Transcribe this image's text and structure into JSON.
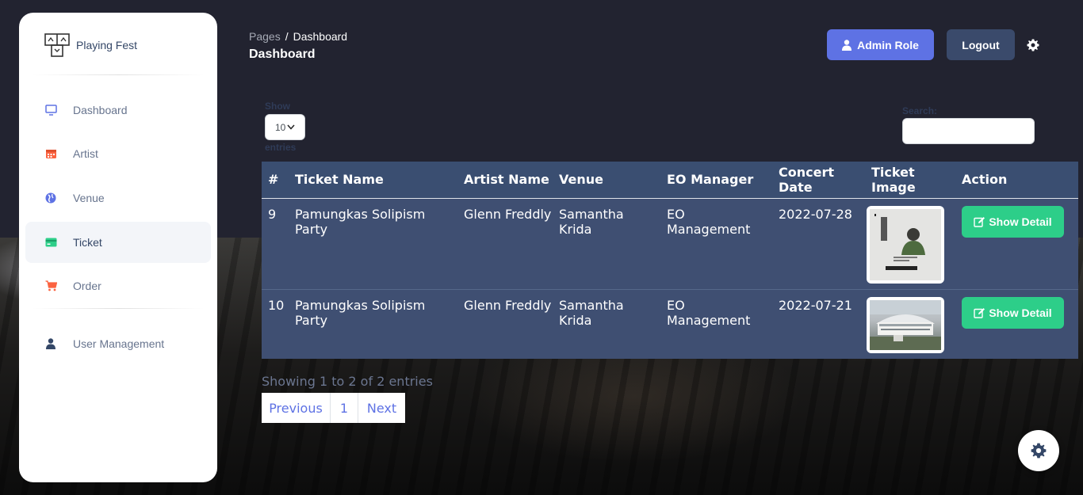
{
  "brand": {
    "name": "Playing Fest"
  },
  "sidebar": {
    "items": [
      {
        "label": "Dashboard",
        "icon": "monitor-icon"
      },
      {
        "label": "Artist",
        "icon": "calendar-icon"
      },
      {
        "label": "Venue",
        "icon": "globe-icon"
      },
      {
        "label": "Ticket",
        "icon": "credit-card-icon",
        "active": true
      },
      {
        "label": "Order",
        "icon": "cart-icon"
      },
      {
        "label": "User Management",
        "icon": "user-icon"
      }
    ]
  },
  "header": {
    "breadcrumb_parent": "Pages",
    "breadcrumb_separator": "/",
    "breadcrumb_current": "Dashboard",
    "title": "Dashboard",
    "admin_button": "Admin Role",
    "logout_button": "Logout"
  },
  "table_controls": {
    "length_show": "Show",
    "length_value": "10",
    "length_entries": "entries",
    "search_label": "Search:",
    "search_value": ""
  },
  "table": {
    "headers": [
      "#",
      "Ticket Name",
      "Artist Name",
      "Venue",
      "EO Manager",
      "Concert Date",
      "Ticket Image",
      "Action"
    ],
    "rows": [
      {
        "id": "9",
        "ticket_name": "Pamungkas Solipism Party",
        "artist": "Glenn Freddly",
        "venue": "Samantha Krida",
        "eo": "EO Management",
        "date": "2022-07-28",
        "action": "Show Detail"
      },
      {
        "id": "10",
        "ticket_name": "Pamungkas Solipism Party",
        "artist": "Glenn Freddly",
        "venue": "Samantha Krida",
        "eo": "EO Management",
        "date": "2022-07-21",
        "action": "Show Detail"
      }
    ]
  },
  "footer": {
    "info": "Showing 1 to 2 of 2 entries",
    "pagination": {
      "previous": "Previous",
      "current": "1",
      "next": "Next"
    }
  },
  "colors": {
    "primary": "#5e72e4",
    "success": "#2dce89",
    "table_header": "#3a4e71",
    "table_row": "#3f4f72"
  }
}
